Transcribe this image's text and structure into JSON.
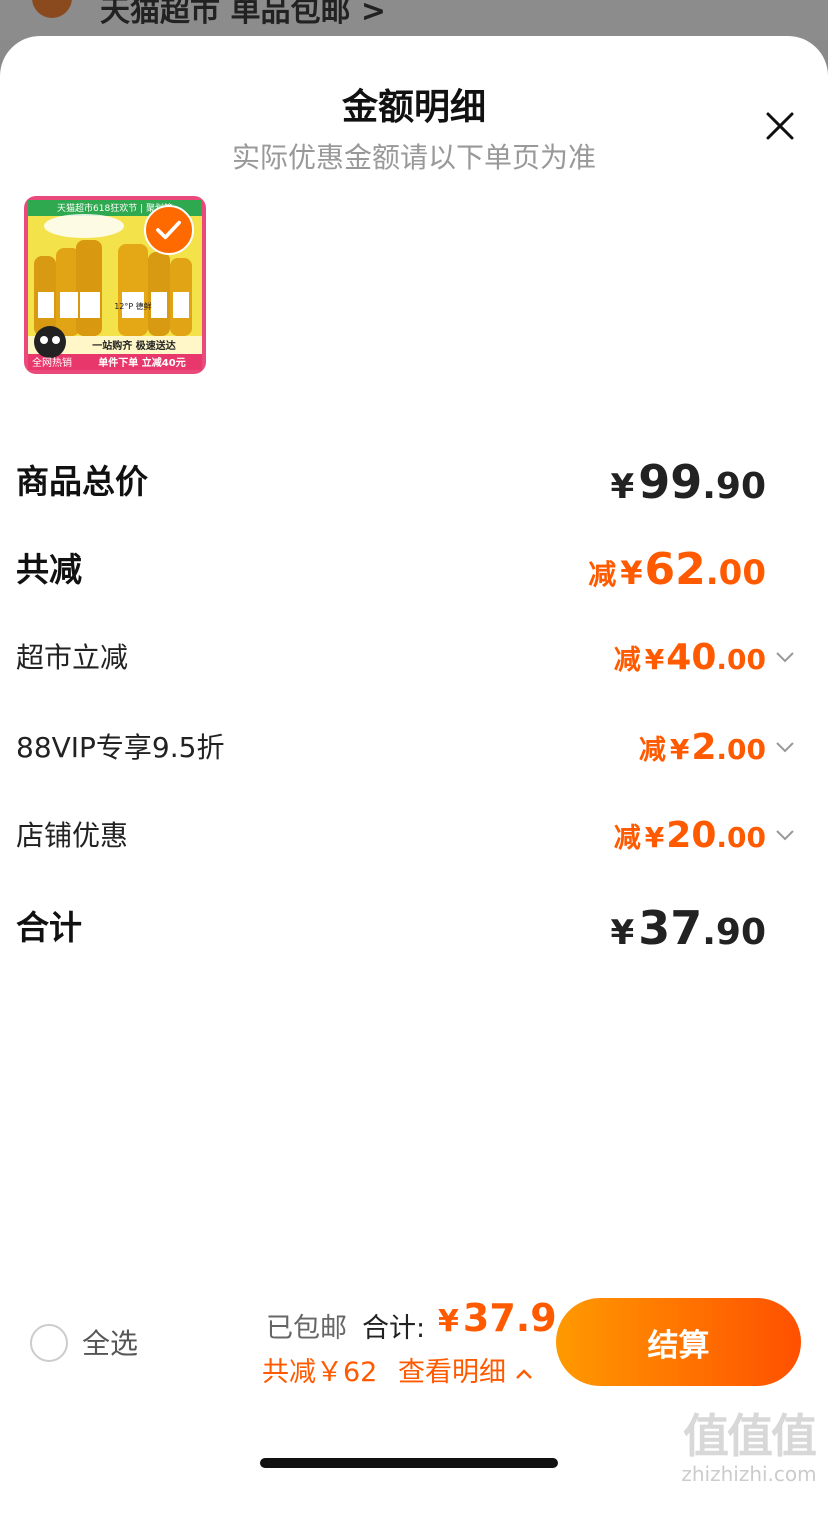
{
  "background": {
    "title_fragment": "天猫超市 单品包邮 >"
  },
  "sheet": {
    "title": "金额明细",
    "subtitle": "实际优惠金额请以下单页为准"
  },
  "product": {
    "banner_top": "天猫超市618狂欢节 | 聚划算",
    "bottle_label": "12°P 德鲜",
    "promo_line": "一站购齐 极速送达",
    "badge_hot": "全网热销",
    "badge_promo": "单件下单 立减40元"
  },
  "rows": [
    {
      "label": "商品总价",
      "prefix": "",
      "currency": "¥",
      "int": "99",
      "dec": ".90"
    },
    {
      "label": "共减",
      "prefix": "减",
      "currency": "¥",
      "int": "62",
      "dec": ".00"
    },
    {
      "label": "超市立减",
      "prefix": "减",
      "currency": "¥",
      "int": "40",
      "dec": ".00"
    },
    {
      "label": "88VIP专享9.5折",
      "prefix": "减",
      "currency": "¥",
      "int": "2",
      "dec": ".00"
    },
    {
      "label": "店铺优惠",
      "prefix": "减",
      "currency": "¥",
      "int": "20",
      "dec": ".00"
    },
    {
      "label": "合计",
      "prefix": "",
      "currency": "¥",
      "int": "37",
      "dec": ".90"
    }
  ],
  "footer": {
    "select_all": "全选",
    "shipping": "已包邮",
    "total_label": "合计:",
    "total_currency": "¥",
    "total_value": "37.9",
    "saving": "共减￥62",
    "detail_link": "查看明细",
    "checkout": "结算"
  },
  "watermark": {
    "logo": "值值值",
    "url": "zhizhizhi.com"
  },
  "colors": {
    "accent": "#ff5a00",
    "button_start": "#ff9a00",
    "button_end": "#ff5000"
  }
}
